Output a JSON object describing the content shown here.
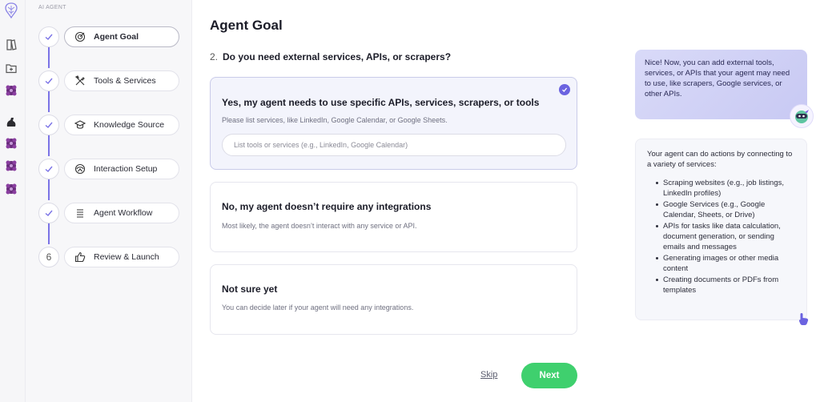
{
  "sidebar": {
    "section_label": "AI AGENT",
    "rail_icons": [
      "brain-logo-icon",
      "book-icon",
      "folder-add-icon",
      "agent-purple-icon",
      "arm-icon",
      "agent-purple-icon",
      "agent-purple-icon",
      "agent-purple-icon"
    ],
    "steps": [
      {
        "label": "Agent Goal",
        "icon": "target-icon",
        "state": "active"
      },
      {
        "label": "Tools & Services",
        "icon": "tools-icon",
        "state": "done"
      },
      {
        "label": "Knowledge Source",
        "icon": "graduation-cap-icon",
        "state": "done"
      },
      {
        "label": "Interaction Setup",
        "icon": "cycle-icon",
        "state": "done"
      },
      {
        "label": "Agent Workflow",
        "icon": "list-icon",
        "state": "done"
      },
      {
        "label": "Review & Launch",
        "icon": "thumbs-up-icon",
        "state": "pending",
        "number": "6"
      }
    ]
  },
  "main": {
    "title": "Agent Goal",
    "question_number": "2.",
    "question": "Do you need external services, APIs, or scrapers?",
    "options": [
      {
        "title": "Yes, my agent needs to use specific APIs, services, scrapers, or tools",
        "description": "Please list services, like LinkedIn, Google Calendar, or Google Sheets.",
        "input_placeholder": "List tools or services (e.g., LinkedIn, Google Calendar)",
        "selected": true
      },
      {
        "title": "No, my agent doesn’t require any integrations",
        "description": "Most likely, the agent doesn’t interact with any service or API.",
        "selected": false
      },
      {
        "title": "Not sure yet",
        "description": "You can decide later if your agent will need any integrations.",
        "selected": false
      }
    ],
    "skip_label": "Skip",
    "next_label": "Next"
  },
  "assistant": {
    "bubble_text": "Nice! Now, you can add external tools, services, or APIs that your agent may need to use, like scrapers, Google services, or other APIs.",
    "info_intro": "Your agent can do actions by connecting to a variety of services:",
    "info_items": [
      "Scraping websites (e.g., job listings, LinkedIn profiles)",
      "Google Services (e.g., Google Calendar, Sheets, or Drive)",
      "APIs for tasks like data calculation, document generation, or sending emails and messages",
      "Generating images or other media content",
      "Creating documents or PDFs from templates"
    ]
  },
  "colors": {
    "accent": "#6b63e0",
    "next_button": "#3fd06e",
    "bubble": "#d2d3f6"
  }
}
